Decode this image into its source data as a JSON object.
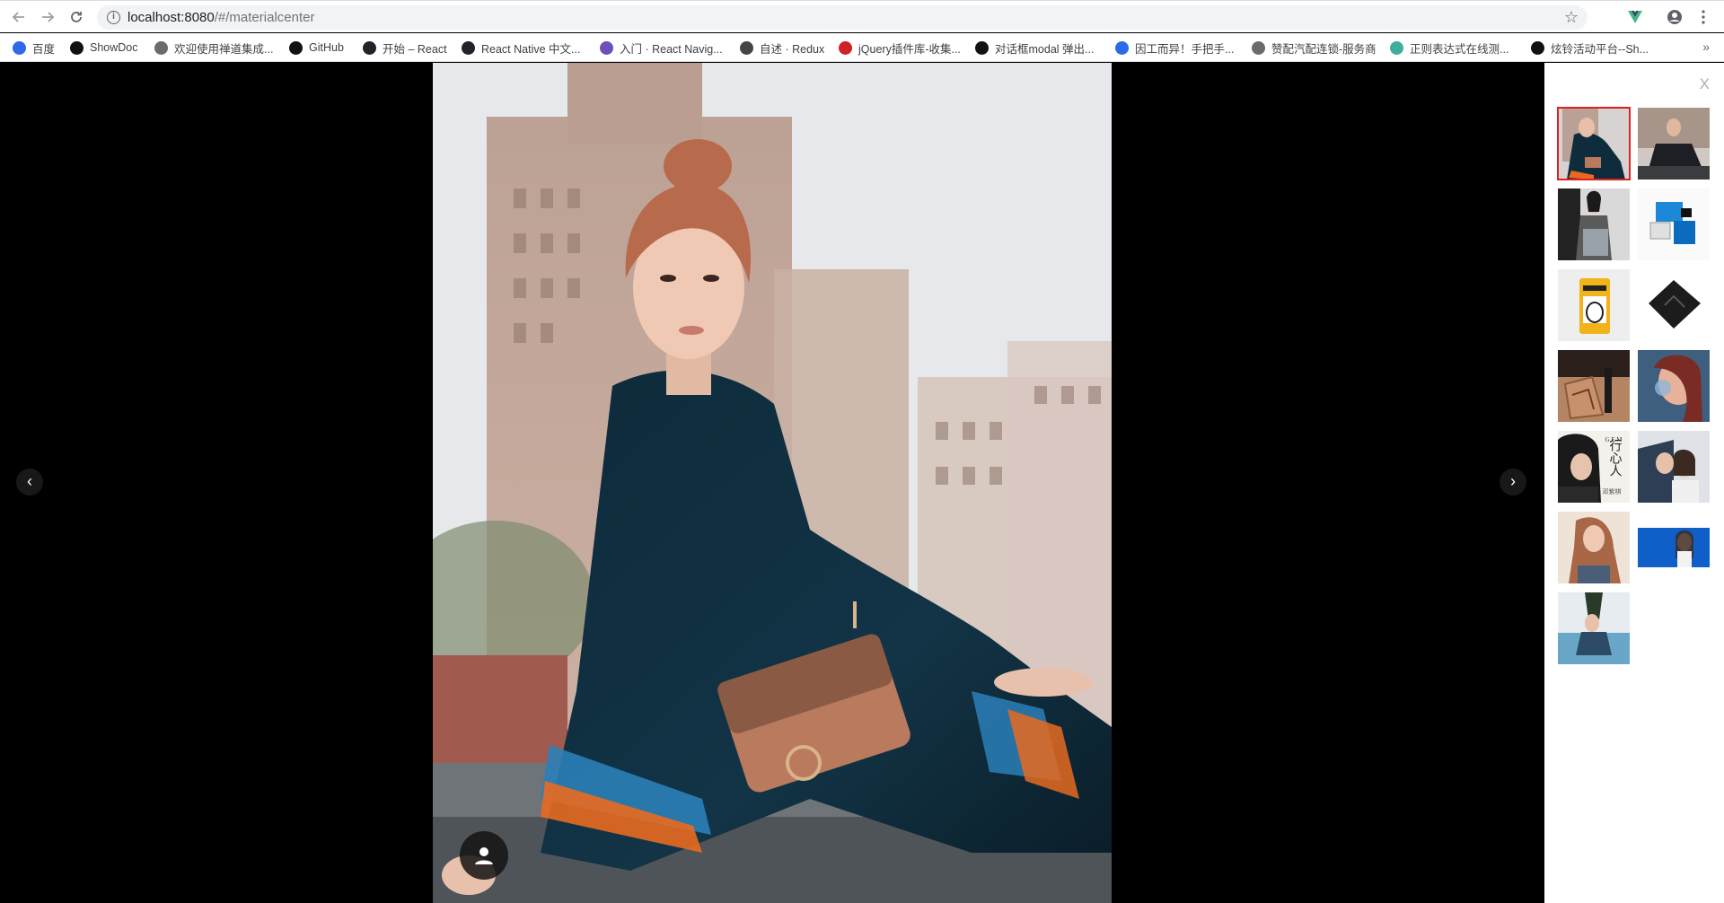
{
  "browser": {
    "url_host": "localhost:8080",
    "url_path": "/#/materialcenter",
    "bookmarks": [
      {
        "label": "百度",
        "color": "#2e6ae6"
      },
      {
        "label": "ShowDoc",
        "color": "#111111"
      },
      {
        "label": "欢迎使用禅道集成...",
        "color": "#6b6b6b"
      },
      {
        "label": "GitHub",
        "color": "#111111"
      },
      {
        "label": "开始 – React",
        "color": "#20232a"
      },
      {
        "label": "React Native 中文...",
        "color": "#20232a"
      },
      {
        "label": "入门 · React Navig...",
        "color": "#6b4fbb"
      },
      {
        "label": "自述 · Redux",
        "color": "#444444"
      },
      {
        "label": "jQuery插件库-收集...",
        "color": "#d0202a"
      },
      {
        "label": "对话框modal 弹出...",
        "color": "#111111"
      },
      {
        "label": "因工而异！手把手...",
        "color": "#2e6ae6"
      },
      {
        "label": "赞配汽配连锁-服务商",
        "color": "#6b6b6b"
      },
      {
        "label": "正则表达式在线测...",
        "color": "#3bb09b"
      },
      {
        "label": "炫铃活动平台--Sh...",
        "color": "#111111"
      }
    ]
  },
  "viewer": {
    "prev_label": "‹",
    "next_label": "›",
    "close_label": "X"
  },
  "thumbnails": [
    {
      "id": "t1",
      "selected": true
    },
    {
      "id": "t2",
      "selected": false
    },
    {
      "id": "t3",
      "selected": false
    },
    {
      "id": "t4",
      "selected": false
    },
    {
      "id": "t5",
      "selected": false
    },
    {
      "id": "t6",
      "selected": false
    },
    {
      "id": "t7",
      "selected": false
    },
    {
      "id": "t8",
      "selected": false
    },
    {
      "id": "t9",
      "selected": false
    },
    {
      "id": "t10",
      "selected": false
    },
    {
      "id": "t11",
      "selected": false
    },
    {
      "id": "t12",
      "selected": false
    },
    {
      "id": "t13",
      "selected": false
    }
  ],
  "thumb_text": {
    "album_letters": "G.E.M",
    "album_title": "行心人",
    "album_artist": "邓紫棋"
  },
  "colors": {
    "selected_border": "#e02020",
    "panel_bg": "#ffffff",
    "viewer_bg": "#000000"
  }
}
